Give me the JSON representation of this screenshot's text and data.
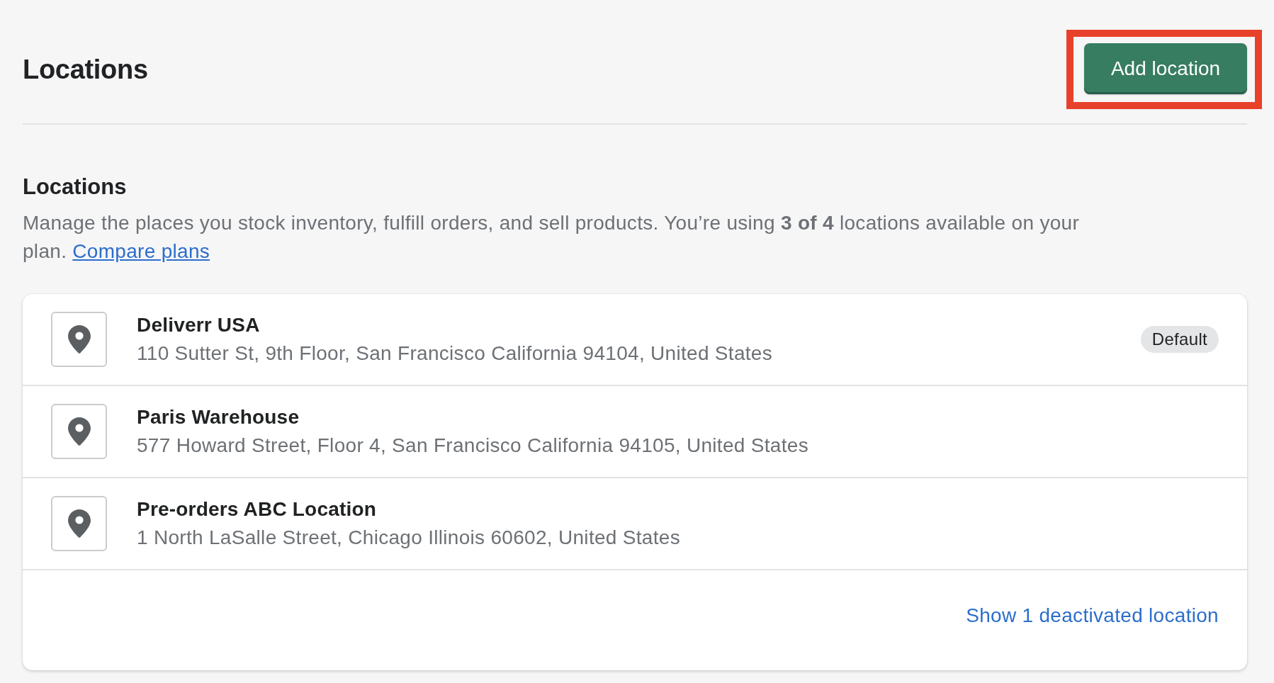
{
  "page": {
    "title": "Locations"
  },
  "add_button": {
    "label": "Add location",
    "highlighted": true
  },
  "section": {
    "heading": "Locations",
    "description": "Manage the places you stock inventory, fulfill orders, and sell products. You’re using **3 of 4** locations available on your plan.",
    "link": "Compare plans"
  },
  "locations": [
    {
      "name": "Deliverr USA",
      "address": "110 Sutter St, 9th Floor, San Francisco California 94104, United States",
      "badge": "Default"
    },
    {
      "name": "Paris Warehouse",
      "address": "577 Howard Street, Floor 4, San Francisco California 94105, United States"
    },
    {
      "name": "Pre-orders ABC Location",
      "address": "1 North LaSalle Street, Chicago Illinois 60602, United States"
    }
  ],
  "footer_link": "Show 1 deactivated location"
}
